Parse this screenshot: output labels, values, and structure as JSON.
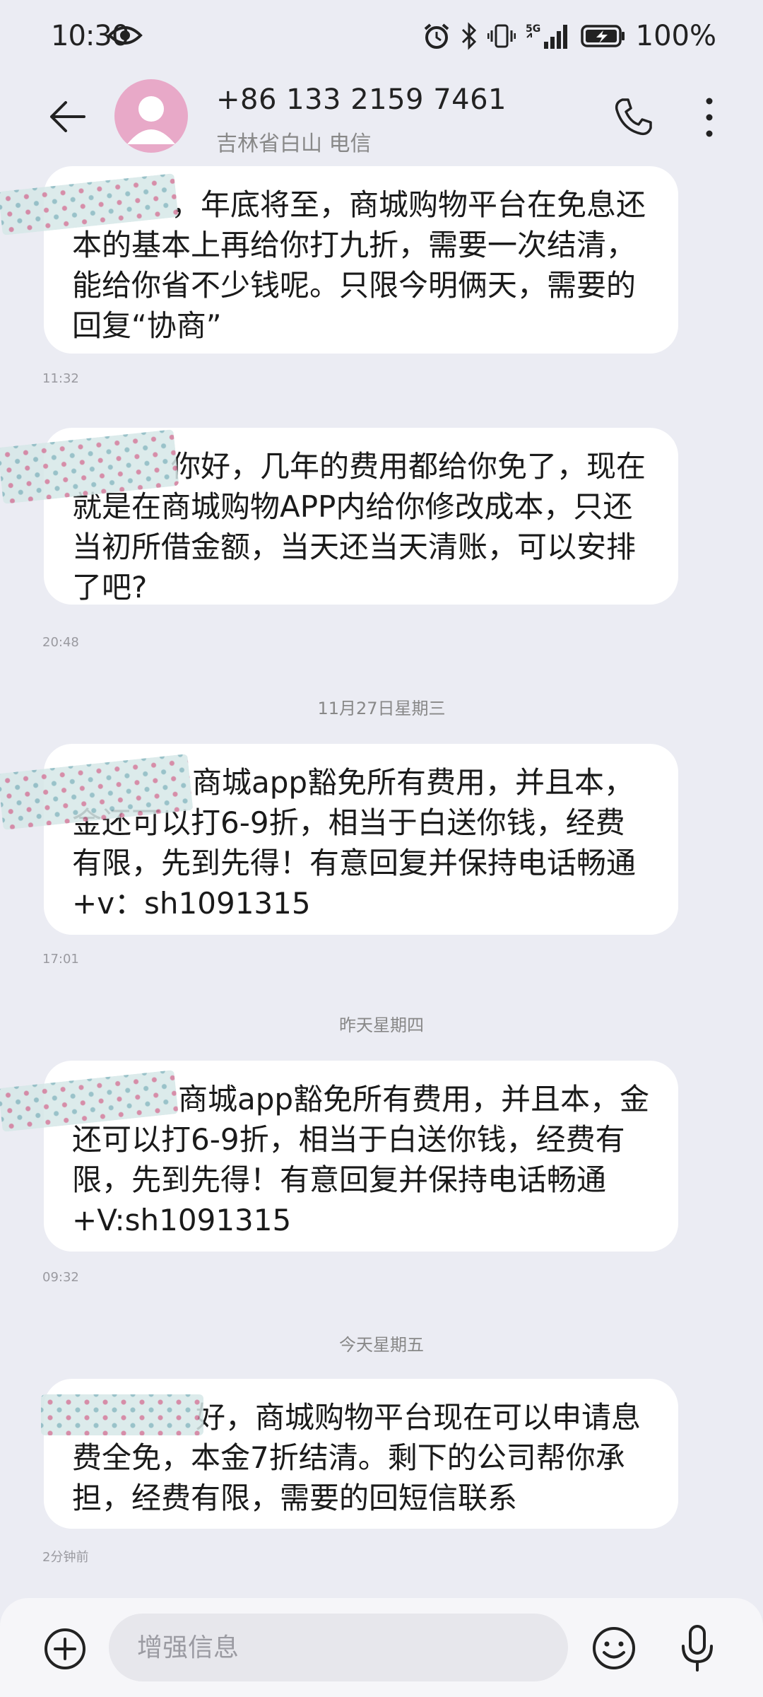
{
  "status_bar": {
    "time": "10:30",
    "network": "5G",
    "battery": "100%"
  },
  "header": {
    "contact_number": "+86 133 2159 7461",
    "contact_location": "吉林省白山 电信"
  },
  "messages": [
    {
      "text": "，年底将至，商城购物平台在免息还本的基本上再给你打九折，需要一次结清，能给你省不少钱呢。只限今明俩天，需要的回复“协商”",
      "time": "11:32"
    },
    {
      "text": "你好，几年的费用都给你免了，现在就是在商城购物APP内给你修改成本，只还当初所借金额，当天还当天清账，可以安排了吧?",
      "time": "20:48"
    },
    {
      "date_separator": "11月27日星期三",
      "text": "商城app豁免所有费用，并且本，金还可以打6-9折，相当于白送你钱，经费有限，先到先得！有意回复并保持电话畅通+v：sh1091315",
      "time": "17:01"
    },
    {
      "date_separator": "昨天星期四",
      "text": "商城app豁免所有费用，并且本，金还可以打6-9折，相当于白送你钱，经费有限，先到先得！有意回复并保持电话畅通+V:sh1091315",
      "time": "09:32"
    },
    {
      "date_separator": "今天星期五",
      "text": "好，商城购物平台现在可以申请息费全免，本金7折结清。剩下的公司帮你承担，经费有限，需要的回短信联系",
      "time": "2分钟前"
    }
  ],
  "composer": {
    "placeholder": "增强信息"
  },
  "colors": {
    "background": "#ebecf3",
    "bubble": "#ffffff",
    "avatar": "#e8a9c8"
  }
}
